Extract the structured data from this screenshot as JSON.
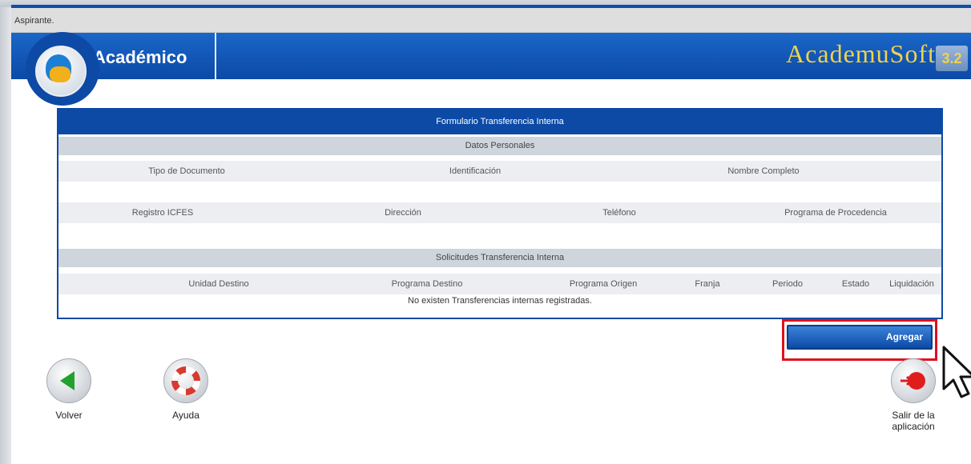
{
  "user": {
    "label": "Aspirante."
  },
  "header": {
    "title": "Académico",
    "brand": "AcademuSoft",
    "version": "3.2"
  },
  "form": {
    "title": "Formulario Transferencia Interna",
    "personal": {
      "section_title": "Datos Personales",
      "row1": [
        "Tipo de Documento",
        "Identificación",
        "Nombre Completo"
      ],
      "row2": [
        "Registro ICFES",
        "Dirección",
        "Teléfono",
        "Programa de Procedencia"
      ]
    },
    "requests": {
      "section_title": "Solicitudes Transferencia Interna",
      "columns": [
        "Unidad Destino",
        "Programa Destino",
        "Programa Origen",
        "Franja",
        "Periodo",
        "Estado",
        "Liquidación"
      ],
      "empty_message": "No existen Transferencias internas registradas."
    }
  },
  "actions": {
    "add_label": "Agregar"
  },
  "footer": {
    "back_label": "Volver",
    "help_label": "Ayuda",
    "exit_label": "Salir de la aplicación"
  },
  "colors": {
    "primary": "#0c4aa6",
    "brand_text": "#f1d24a",
    "highlight": "#e0101e"
  }
}
